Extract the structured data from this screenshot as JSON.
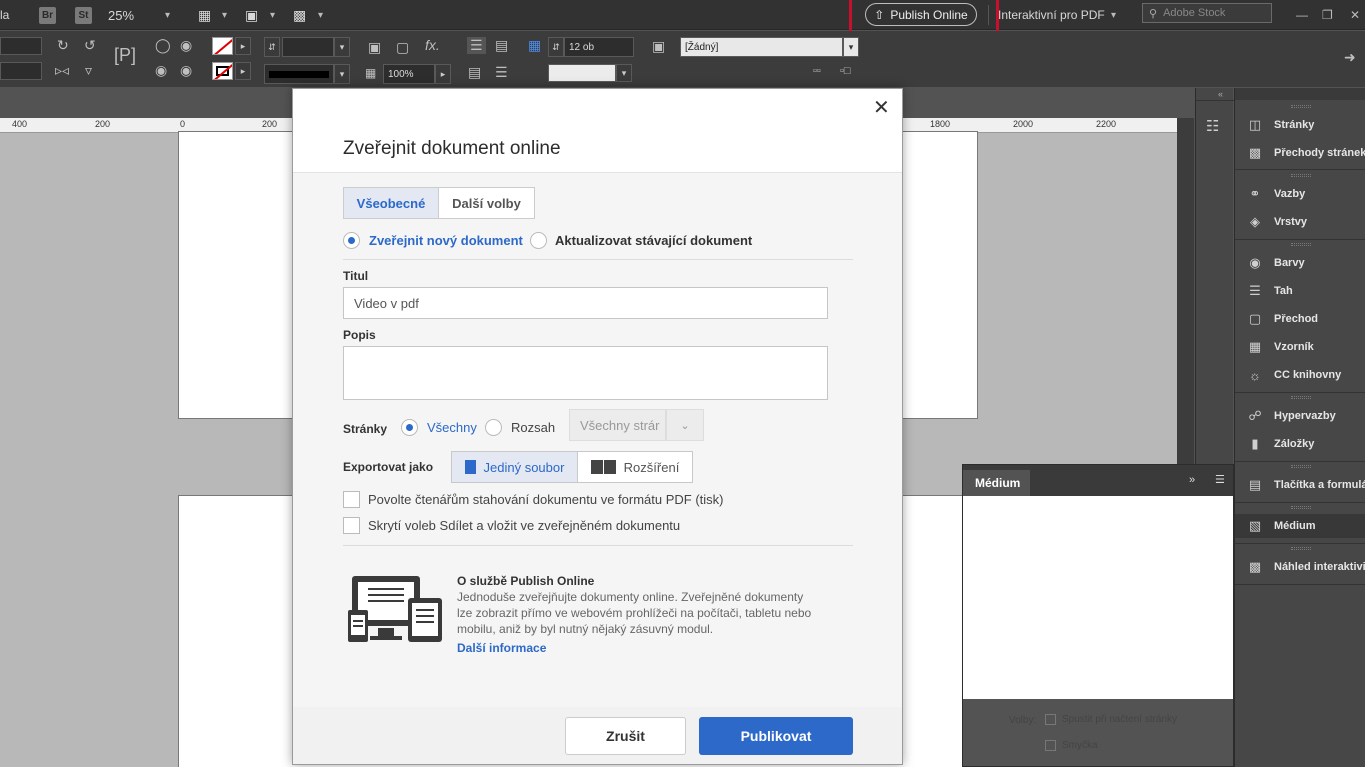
{
  "appbar": {
    "app_fragment": "la",
    "bridge_label": "Br",
    "stock_label": "St",
    "zoom": "25%",
    "publish_online": "Publish Online",
    "workspace": "Interaktivní pro PDF",
    "search_placeholder": "Adobe Stock"
  },
  "control_bar": {
    "leading": "12 ob",
    "scale": "100%",
    "style": "[Žádný]"
  },
  "ruler": {
    "ticks": [
      "400",
      "200",
      "0",
      "200",
      "1800",
      "2000",
      "2200"
    ]
  },
  "dialog": {
    "title": "Zveřejnit dokument online",
    "tabs": [
      "Všeobecné",
      "Další volby"
    ],
    "radio_new": "Zveřejnit nový dokument",
    "radio_update": "Aktualizovat stávající dokument",
    "title_label": "Titul",
    "title_value": "Video v pdf",
    "desc_label": "Popis",
    "desc_value": "",
    "pages_label": "Stránky",
    "pages_all": "Všechny",
    "pages_range": "Rozsah",
    "pages_select": "Všechny strár",
    "export_label": "Exportovat jako",
    "export_single": "Jediný soubor",
    "export_spreads": "Rozšíření",
    "cb_download": "Povolte čtenářům stahování dokumentu ve formátu PDF (tisk)",
    "cb_hide_share": "Skrytí voleb Sdílet a vložit ve zveřejněném dokumentu",
    "about_title": "O službě Publish Online",
    "about_lines": [
      "Jednoduše zveřejňujte dokumenty online. Zveřejněné dokumenty",
      "lze zobrazit přímo ve webovém prohlížeči na počítači, tabletu nebo",
      "mobilu, aniž by byl nutný nějaký zásuvný modul."
    ],
    "more_info": "Další informace",
    "cancel": "Zrušit",
    "publish": "Publikovat"
  },
  "panels": {
    "items": [
      {
        "label": "Stránky",
        "icon": "pages-icon"
      },
      {
        "label": "Přechody stránek",
        "icon": "page-transitions-icon"
      },
      {
        "label": "Vazby",
        "icon": "links-icon"
      },
      {
        "label": "Vrstvy",
        "icon": "layers-icon"
      },
      {
        "label": "Barvy",
        "icon": "swatches-icon"
      },
      {
        "label": "Tah",
        "icon": "stroke-icon"
      },
      {
        "label": "Přechod",
        "icon": "gradient-icon"
      },
      {
        "label": "Vzorník",
        "icon": "sample-icon"
      },
      {
        "label": "CC knihovny",
        "icon": "cc-libraries-icon"
      },
      {
        "label": "Hypervazby",
        "icon": "hyperlinks-icon"
      },
      {
        "label": "Záložky",
        "icon": "bookmarks-icon"
      },
      {
        "label": "Tlačítka a formuláře",
        "icon": "buttons-forms-icon"
      },
      {
        "label": "Médium",
        "icon": "media-icon"
      },
      {
        "label": "Náhled interaktivity",
        "icon": "interactivity-preview-icon"
      }
    ]
  },
  "medium_panel": {
    "tab": "Médium",
    "options_label": "Volby:",
    "opt_autoplay": "Spustit při načtení stránky",
    "opt_loop": "Smyčka"
  },
  "colors": {
    "accent": "#2c69c9",
    "highlight": "#c8102e"
  }
}
